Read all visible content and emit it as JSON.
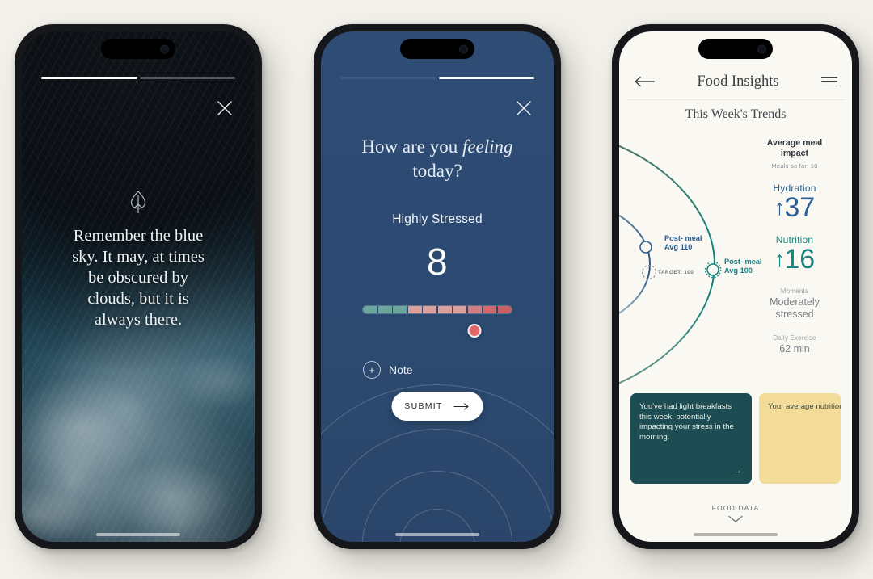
{
  "canvas": {
    "background": "#f2f0ea"
  },
  "phones": {
    "quote_screen": {
      "name": "Mindfulness quote screen",
      "progress": {
        "steps": 2,
        "active_index": 0,
        "fill_color": "#ffffff",
        "track_color": "#55585c"
      },
      "close_icon": "close-icon",
      "leaf_icon": "leaf-icon",
      "quote": "Remember the blue sky. It may, at times be obscured by clouds, but it is always there."
    },
    "mood_screen": {
      "name": "Mood check-in screen",
      "background_color": "#2d4a70",
      "progress": {
        "steps": 2,
        "active_index": 1,
        "fill_color": "#ffffff",
        "track_color": "#3e5d85"
      },
      "close_icon": "close-icon",
      "question_line1": "How are you ",
      "question_emphasis": "feeling",
      "question_line2": "today?",
      "mood_label": "Highly Stressed",
      "mood_value": "8",
      "slider": {
        "segments": 10,
        "value": 8,
        "min": 1,
        "max": 10,
        "colors": [
          "#6aa69b",
          "#6aa69b",
          "#6aa69b",
          "#dba09c",
          "#dba09c",
          "#dba09c",
          "#dba09c",
          "#d07d7f",
          "#cc6a6e",
          "#c85f63"
        ],
        "thumb_color": "#e2656a"
      },
      "note_button": {
        "icon": "plus-circle-icon",
        "label": "Note"
      },
      "submit_button": {
        "label": "SUBMIT",
        "icon": "arrow-right-icon"
      }
    },
    "insights_screen": {
      "name": "Food Insights screen",
      "background_color": "#faf8f2",
      "header": {
        "back_icon": "arrow-left-icon",
        "title": "Food Insights",
        "menu_icon": "hamburger-menu-icon"
      },
      "subtitle": "This Week's Trends",
      "chart": {
        "points": [
          {
            "id": "outer",
            "label_line1": "Post- meal",
            "label_line2": "Avg 100",
            "color": "#17867f"
          },
          {
            "id": "inner",
            "label_line1": "Post- meal",
            "label_line2": "Avg 110",
            "color": "#2a5b8c"
          }
        ],
        "target_label": "TARGET: 100"
      },
      "stats": {
        "heading_line1": "Average meal",
        "heading_line2": "impact",
        "meals_so_far": "Meals so far: 10",
        "metrics": [
          {
            "name": "Hydration",
            "arrow": "↑",
            "value": "37",
            "color": "#2c5f93"
          },
          {
            "name": "Nutrition",
            "arrow": "↑",
            "value": "16",
            "color": "#17867f"
          }
        ],
        "moments": {
          "key": "Moments",
          "value_line1": "Moderately",
          "value_line2": "stressed"
        },
        "exercise": {
          "key": "Daily Exercise",
          "value": "62 min"
        }
      },
      "cards": [
        {
          "id": "breakfast-insight",
          "text": "You've had light breakfasts this week, potentially impacting your stress in the morning.",
          "background": "#1d4d53",
          "arrow": "→"
        },
        {
          "id": "nutrition-insight",
          "text": "Your average nutrition score this week has been right on point!",
          "background": "#f3dc9a"
        }
      ],
      "food_data": {
        "label": "FOOD DATA",
        "icon": "chevron-down-icon"
      }
    }
  }
}
